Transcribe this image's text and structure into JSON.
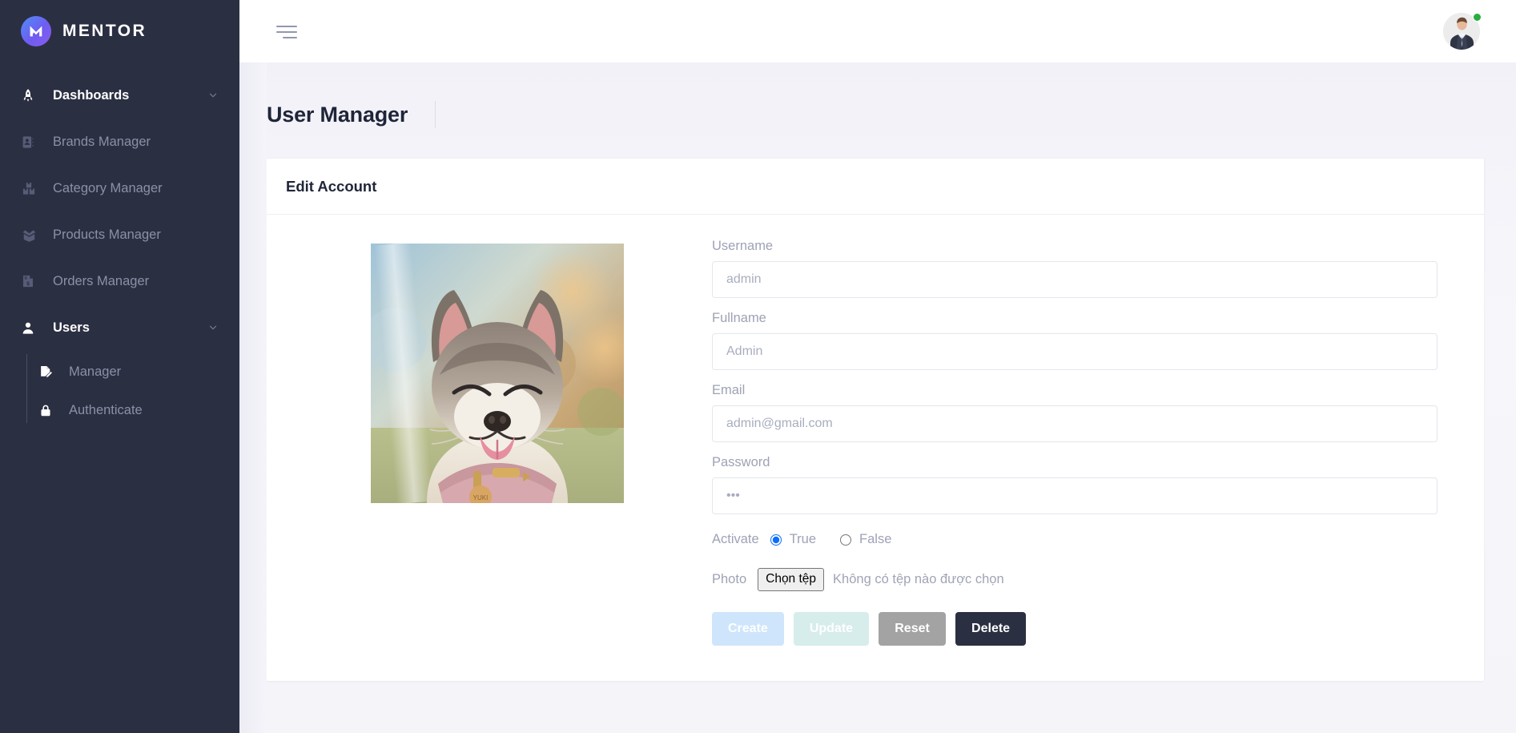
{
  "brand": {
    "name": "MENTOR",
    "logo_icon": "mentor-m-logo"
  },
  "sidebar": {
    "items": [
      {
        "label": "Dashboards",
        "icon": "rocket-icon",
        "active": true,
        "has_chevron": true
      },
      {
        "label": "Brands Manager",
        "icon": "address-book-icon",
        "active": false,
        "has_chevron": false
      },
      {
        "label": "Category Manager",
        "icon": "boxes-icon",
        "active": false,
        "has_chevron": false
      },
      {
        "label": "Products Manager",
        "icon": "open-box-icon",
        "active": false,
        "has_chevron": false
      },
      {
        "label": "Orders Manager",
        "icon": "invoice-icon",
        "active": false,
        "has_chevron": false
      },
      {
        "label": "Users",
        "icon": "user-icon",
        "active": true,
        "has_chevron": true
      }
    ],
    "submenu": [
      {
        "label": "Manager",
        "icon": "file-edit-icon"
      },
      {
        "label": "Authenticate",
        "icon": "lock-icon"
      }
    ]
  },
  "topbar": {
    "menu_toggle_icon": "hamburger-icon",
    "avatar_icon": "user-avatar-photo",
    "status": "online",
    "status_color": "#27ae3f"
  },
  "page": {
    "title": "User Manager"
  },
  "card": {
    "title": "Edit Account",
    "photo_alt": "smiling-dog-photo"
  },
  "form": {
    "fields": [
      {
        "label": "Username",
        "placeholder": "admin",
        "value": "",
        "type": "text"
      },
      {
        "label": "Fullname",
        "placeholder": "Admin",
        "value": "",
        "type": "text"
      },
      {
        "label": "Email",
        "placeholder": "admin@gmail.com",
        "value": "",
        "type": "text"
      },
      {
        "label": "Password",
        "placeholder": "•••",
        "value": "",
        "type": "password"
      }
    ],
    "activate": {
      "label": "Activate",
      "options": [
        {
          "label": "True",
          "checked": true
        },
        {
          "label": "False",
          "checked": false
        }
      ]
    },
    "photo": {
      "label": "Photo",
      "button_label": "Chọn tệp",
      "status_text": "Không có tệp nào được chọn"
    },
    "buttons": [
      {
        "label": "Create",
        "style": "create",
        "color": "#cfe5fb"
      },
      {
        "label": "Update",
        "style": "update",
        "color": "#d6edeb"
      },
      {
        "label": "Reset",
        "style": "reset",
        "color": "#a3a3a3"
      },
      {
        "label": "Delete",
        "style": "delete",
        "color": "#2b2f42"
      }
    ]
  },
  "colors": {
    "sidebar_bg": "#2b2f42",
    "page_bg": "#f4f4f9",
    "accent": "#6f5cf0",
    "text_dark": "#1f2539",
    "text_muted": "#9ea2b5"
  }
}
